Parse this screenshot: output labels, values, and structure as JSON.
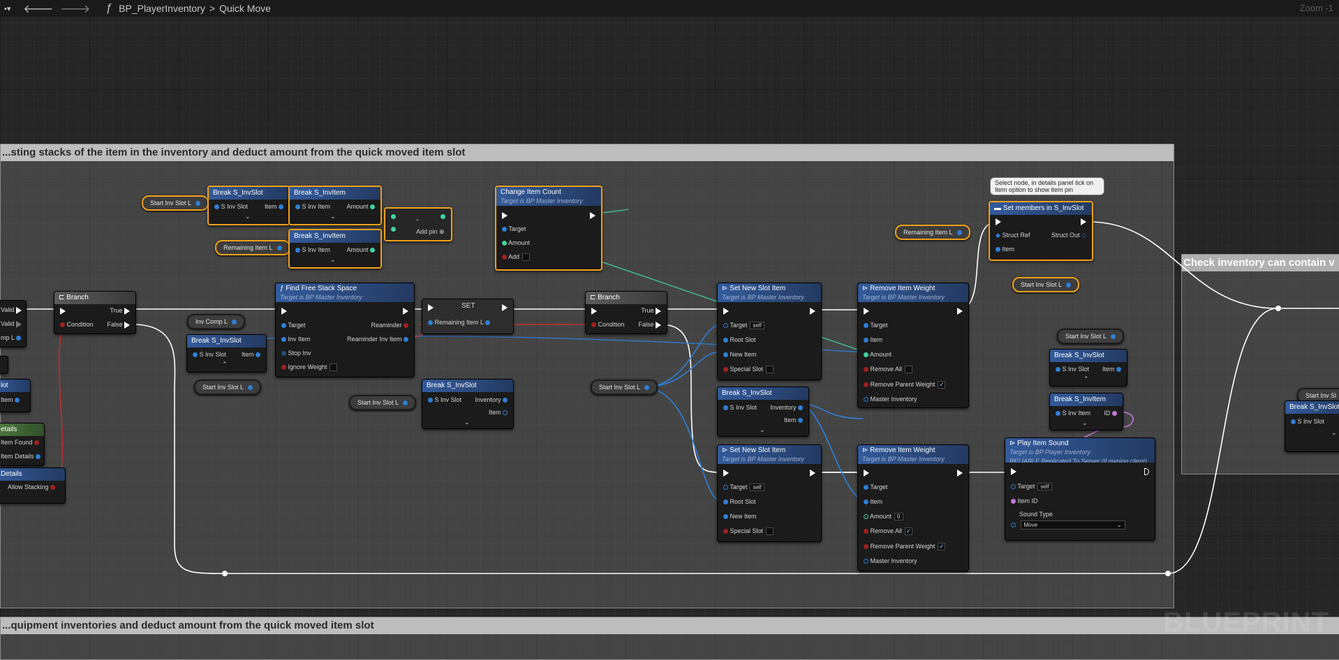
{
  "topbar": {
    "function_icon": "ƒ",
    "blueprint": "BP_PlayerInventory",
    "separator": ">",
    "graph": "Quick Move",
    "zoom": "Zoom -1"
  },
  "comments": [
    {
      "title": "...sting stacks of the item in the inventory and deduct amount from the quick moved item slot"
    },
    {
      "title": "Check inventory can contain v"
    },
    {
      "title": "...quipment inventories and deduct amount from the quick moved item slot"
    }
  ],
  "watermark": "BLUEPRINT",
  "tooltip": "Select node, in details panel tick on Item option to show item pin",
  "vars": {
    "start_inv_slot": "Start Inv Slot L",
    "remaining_item": "Remaining Item L",
    "inv_comp": "Inv Comp L"
  },
  "left_edge": {
    "valid1": "Valid",
    "valid2": "Valid",
    "comp": "mp L",
    "slot": "lot",
    "item": "Item",
    "details": "etails",
    "item_found": "Item Found",
    "item_details": "Item Details",
    "details2": "Details",
    "allow_stacking": "Allow Stacking"
  },
  "nodes": {
    "break_invslot": "Break S_InvSlot",
    "break_invitem": "Break S_InvItem",
    "s_inv_slot": "S Inv Slot",
    "s_inv_item": "S Inv Item",
    "item": "Item",
    "amount": "Amount",
    "add_pin": "Add pin",
    "minus": "-",
    "change_count": {
      "title": "Change Item Count",
      "sub": "Target is BP Master Inventory",
      "target": "Target",
      "amount": "Amount",
      "add": "Add"
    },
    "branch": {
      "title": "Branch",
      "true": "True",
      "false": "False",
      "condition": "Condition"
    },
    "find_free": {
      "title": "Find Free Stack Space",
      "sub": "Target is BP Master Inventory",
      "target": "Target",
      "inv_item": "Inv Item",
      "stop_inv": "Stop Inv",
      "ignore_weight": "Ignore Weight",
      "reaminder": "Reaminder",
      "reaminder_inv_item": "Reaminder Inv Item"
    },
    "set": {
      "title": "SET",
      "remaining": "Remaining Item L"
    },
    "inventory": "Inventory",
    "set_new_slot": {
      "title": "Set New Slot Item",
      "sub": "Target is BP Master Inventory",
      "target": "Target",
      "self": "self",
      "root_slot": "Root Slot",
      "new_item": "New Item",
      "special_slot": "Special Slot"
    },
    "remove_weight": {
      "title": "Remove Item Weight",
      "sub": "Target is BP Master Inventory",
      "target": "Target",
      "item": "Item",
      "amount": "Amount",
      "amount_val": "0",
      "remove_all": "Remove All",
      "remove_parent": "Remove Parent Weight",
      "master": "Master Inventory"
    },
    "set_members": {
      "title": "Set members in S_InvSlot",
      "struct_ref": "Struct Ref",
      "struct_out": "Struct Out",
      "item": "Item"
    },
    "play_sound": {
      "title": "Play Item Sound",
      "sub1": "Target is BP Player Inventory",
      "sub2": "RELIABLE Replicated To Server (if owning client)",
      "target": "Target",
      "self": "self",
      "item_id": "Item ID",
      "sound_type": "Sound Type",
      "sound_val": "Move"
    },
    "id": "ID",
    "start_inv_short": "Start Inv Sl"
  }
}
